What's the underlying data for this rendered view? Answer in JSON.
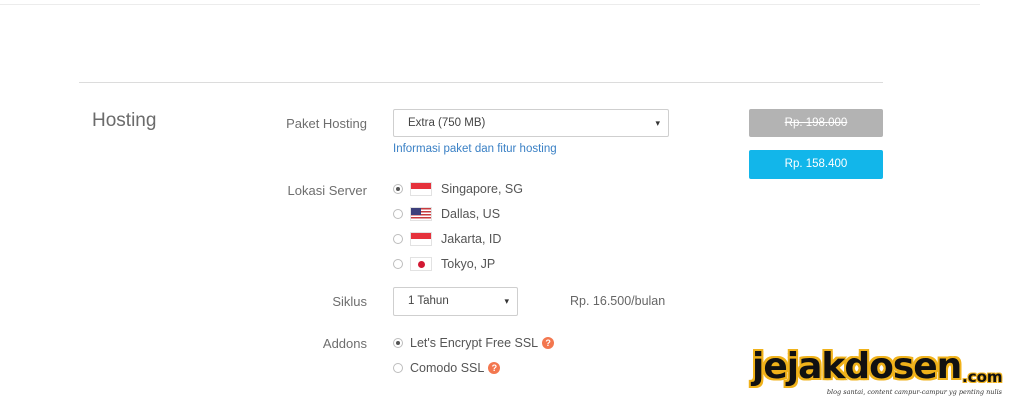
{
  "section": {
    "title": "Hosting"
  },
  "paket": {
    "label": "Paket Hosting",
    "selected": "Extra (750 MB)",
    "caret": "▾",
    "info_link": "Informasi paket dan fitur hosting"
  },
  "pricing": {
    "old_price": "Rp. 198.000",
    "price": "Rp. 158.400",
    "old_color": "#b3b3b3",
    "accent_color": "#12b6ea"
  },
  "lokasi": {
    "label": "Lokasi Server",
    "options": [
      {
        "label": "Singapore, SG",
        "flag": "flag-sg-icon",
        "selected": true
      },
      {
        "label": "Dallas, US",
        "flag": "flag-us-icon",
        "selected": false
      },
      {
        "label": "Jakarta, ID",
        "flag": "flag-id-icon",
        "selected": false
      },
      {
        "label": "Tokyo, JP",
        "flag": "flag-jp-icon",
        "selected": false
      }
    ]
  },
  "siklus": {
    "label": "Siklus",
    "selected": "1 Tahun",
    "caret": "▾",
    "per_month": "Rp. 16.500/bulan"
  },
  "addons": {
    "label": "Addons",
    "help_glyph": "?",
    "options": [
      {
        "label": "Let's Encrypt Free SSL",
        "selected": true
      },
      {
        "label": "Comodo SSL",
        "selected": false
      }
    ]
  },
  "watermark": {
    "name": "jejakdosen",
    "suffix": ".com",
    "tagline": "blog santai, content campur-campur yg penting nulis"
  }
}
